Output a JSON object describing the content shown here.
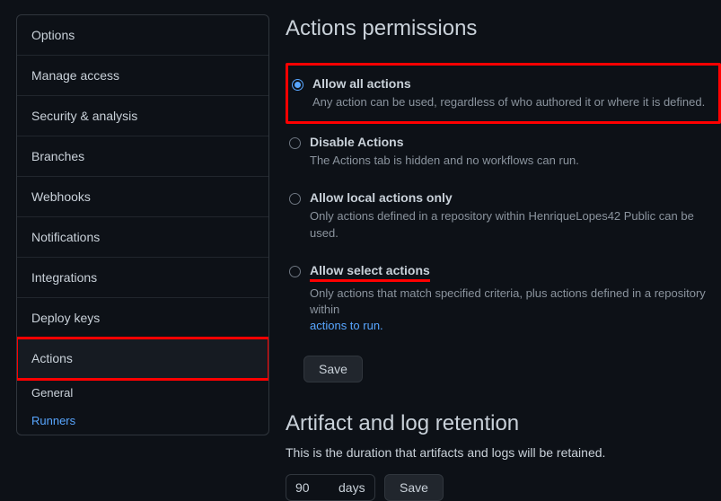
{
  "sidebar": {
    "items": [
      {
        "label": "Options"
      },
      {
        "label": "Manage access"
      },
      {
        "label": "Security & analysis"
      },
      {
        "label": "Branches"
      },
      {
        "label": "Webhooks"
      },
      {
        "label": "Notifications"
      },
      {
        "label": "Integrations"
      },
      {
        "label": "Deploy keys"
      },
      {
        "label": "Actions"
      }
    ],
    "subitems": [
      {
        "label": "General"
      },
      {
        "label": "Runners"
      }
    ]
  },
  "permissions": {
    "heading": "Actions permissions",
    "options": [
      {
        "label": "Allow all actions",
        "desc": "Any action can be used, regardless of who authored it or where it is defined."
      },
      {
        "label": "Disable Actions",
        "desc": "The Actions tab is hidden and no workflows can run."
      },
      {
        "label": "Allow local actions only",
        "desc": "Only actions defined in a repository within HenriqueLopes42 Public can be used."
      },
      {
        "label": "Allow select actions",
        "desc_prefix": "Only actions that match specified criteria, plus actions defined in a repository within ",
        "desc_link": "actions to run."
      }
    ],
    "save": "Save"
  },
  "retention": {
    "heading": "Artifact and log retention",
    "desc": "This is the duration that artifacts and logs will be retained.",
    "value": "90",
    "unit": "days",
    "save": "Save"
  }
}
